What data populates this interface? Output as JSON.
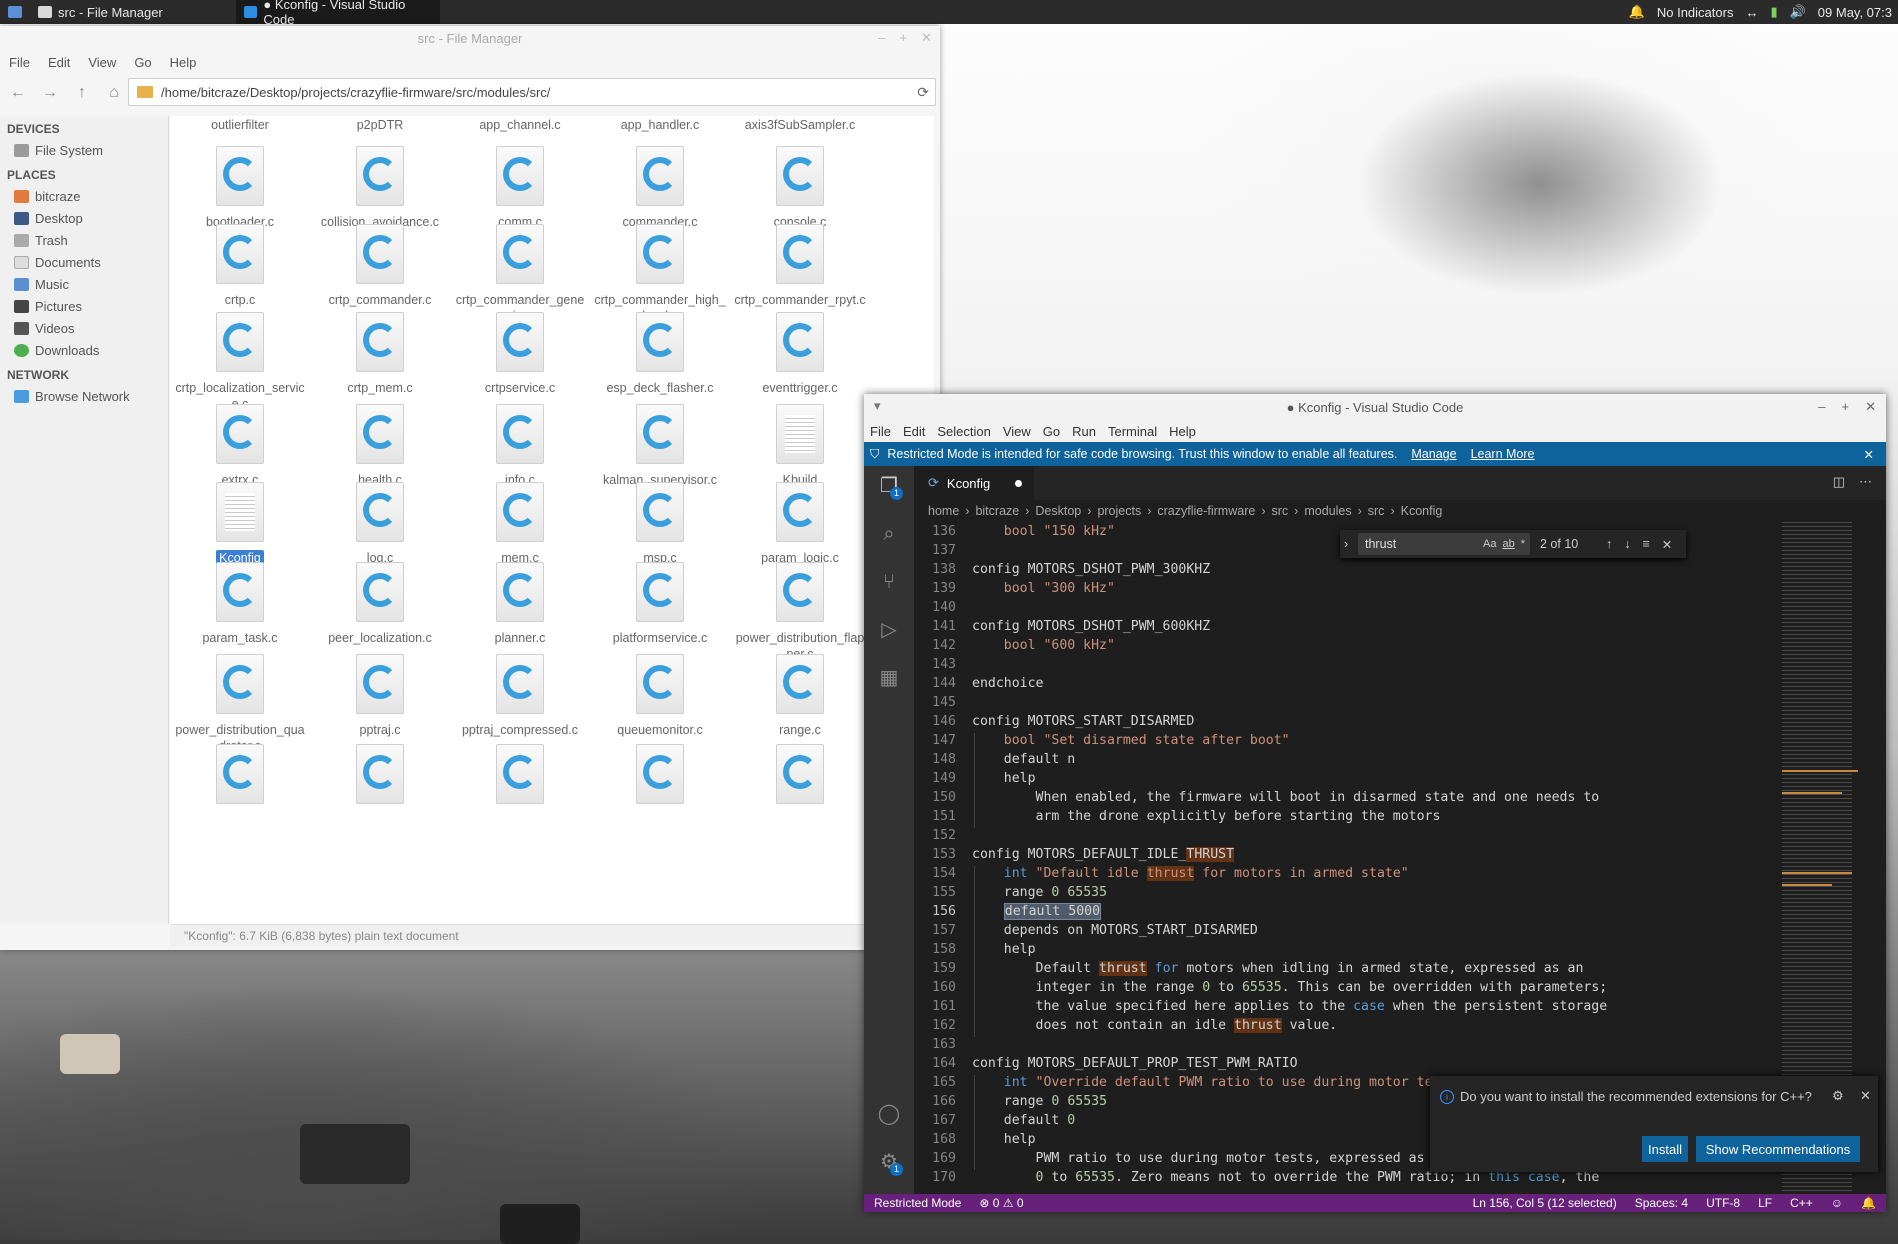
{
  "panel": {
    "task1": "src - File Manager",
    "task2": "● Kconfig - Visual Studio Code",
    "indicators": "No Indicators",
    "clock": "09 May, 07:3"
  },
  "fm": {
    "title": "src - File Manager",
    "menu": [
      "File",
      "Edit",
      "View",
      "Go",
      "Help"
    ],
    "path": "/home/bitcraze/Desktop/projects/crazyflie-firmware/src/modules/src/",
    "devices_header": "DEVICES",
    "places_header": "PLACES",
    "network_header": "NETWORK",
    "devices": [
      "File System"
    ],
    "places": [
      "bitcraze",
      "Desktop",
      "Trash",
      "Documents",
      "Music",
      "Pictures",
      "Videos",
      "Downloads"
    ],
    "network": [
      "Browse Network"
    ],
    "top_row": [
      "outlierfilter",
      "p2pDTR",
      "app_channel.c",
      "app_handler.c",
      "axis3fSubSampler.c"
    ],
    "files": [
      [
        "bootloader.c",
        "collision_avoidance.c",
        "comm.c",
        "commander.c",
        "console.c"
      ],
      [
        "crtp.c",
        "crtp_commander.c",
        "crtp_commander_generic.c",
        "crtp_commander_high_level.c",
        "crtp_commander_rpyt.c"
      ],
      [
        "crtp_localization_service.c",
        "crtp_mem.c",
        "crtpservice.c",
        "esp_deck_flasher.c",
        "eventtrigger.c"
      ],
      [
        "extrx.c",
        "health.c",
        "info.c",
        "kalman_supervisor.c",
        "Kbuild"
      ],
      [
        "Kconfig",
        "log.c",
        "mem.c",
        "msp.c",
        "param_logic.c"
      ],
      [
        "param_task.c",
        "peer_localization.c",
        "planner.c",
        "platformservice.c",
        "power_distribution_flapper.c"
      ],
      [
        "power_distribution_quadrotor.c",
        "pptraj.c",
        "pptraj_compressed.c",
        "queuemonitor.c",
        "range.c"
      ],
      [
        "",
        "",
        "",
        "",
        ""
      ]
    ],
    "status": "\"Kconfig\": 6.7 KiB (6,838 bytes) plain text document"
  },
  "vs": {
    "title": "● Kconfig - Visual Studio Code",
    "menu": [
      "File",
      "Edit",
      "Selection",
      "View",
      "Go",
      "Run",
      "Terminal",
      "Help"
    ],
    "banner": "Restricted Mode is intended for safe code browsing. Trust this window to enable all features.",
    "banner_manage": "Manage",
    "banner_learn": "Learn More",
    "tab": "Kconfig",
    "breadcrumbs": [
      "home",
      "bitcraze",
      "Desktop",
      "projects",
      "crazyflie-firmware",
      "src",
      "modules",
      "src",
      "Kconfig"
    ],
    "find": {
      "query": "thrust",
      "count": "2 of 10",
      "opts": [
        "Aa",
        "ab",
        "*"
      ]
    },
    "toast": {
      "message": "Do you want to install the recommended extensions for C++?",
      "install": "Install",
      "show": "Show Recommendations"
    },
    "status_left": [
      "Restricted Mode",
      "⊗ 0 ⚠ 0"
    ],
    "status_right": [
      "Ln 156, Col 5 (12 selected)",
      "Spaces: 4",
      "UTF-8",
      "LF",
      "C++"
    ]
  }
}
